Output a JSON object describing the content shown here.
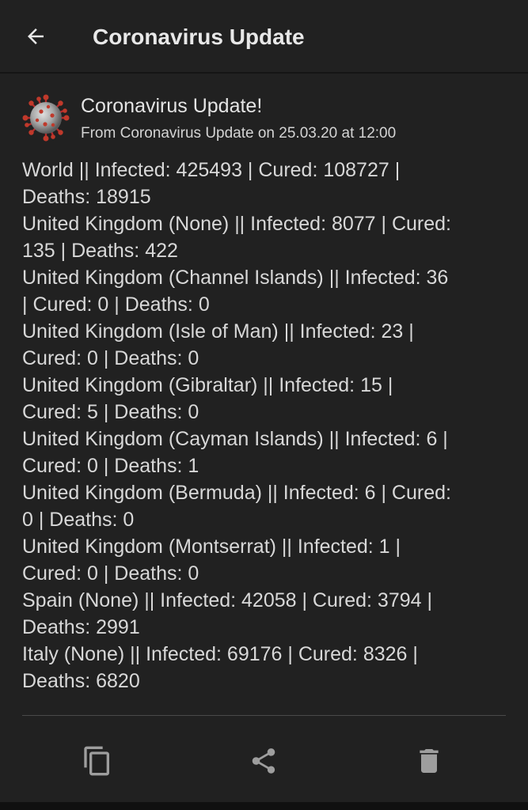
{
  "appbar": {
    "title": "Coronavirus Update",
    "back_icon": "arrow-left-icon"
  },
  "notification": {
    "app_icon": "coronavirus-icon",
    "title": "Coronavirus Update!",
    "subtitle": "From Coronavirus Update on 25.03.20 at 12:00",
    "body_lines": [
      "World || Infected: 425493 | Cured: 108727 |",
      "Deaths: 18915",
      "United Kingdom (None) || Infected: 8077 | Cured:",
      "135 | Deaths: 422",
      "United Kingdom (Channel Islands) || Infected: 36",
      "| Cured: 0 | Deaths: 0",
      "United Kingdom (Isle of Man) || Infected: 23 |",
      "Cured: 0 | Deaths: 0",
      "United Kingdom (Gibraltar) || Infected: 15 |",
      "Cured: 5 | Deaths: 0",
      "United Kingdom (Cayman Islands) || Infected: 6 |",
      "Cured: 0 | Deaths: 1",
      "United Kingdom (Bermuda) || Infected: 6 | Cured:",
      "0 | Deaths: 0",
      "United Kingdom (Montserrat) || Infected: 1 |",
      "Cured: 0 | Deaths: 0",
      "Spain (None) || Infected: 42058 | Cured: 3794 |",
      "Deaths: 2991",
      "Italy (None) || Infected: 69176 | Cured: 8326 |",
      "Deaths: 6820"
    ]
  },
  "actions": {
    "copy_icon": "copy-icon",
    "share_icon": "share-icon",
    "delete_icon": "delete-icon"
  },
  "colors": {
    "background": "#171717",
    "surface": "#212121",
    "text_primary": "#e4e4e4",
    "text_body": "#d8d8d8",
    "icon": "#9e9e9e"
  }
}
